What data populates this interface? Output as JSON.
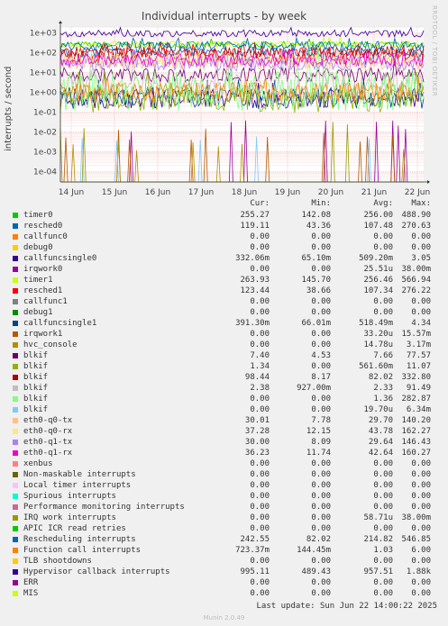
{
  "chart_data": {
    "type": "line",
    "title": "Individual interrupts - by week",
    "ylabel": "interrupts / second",
    "y_scale": "log",
    "ylim": [
      3e-05,
      2000
    ],
    "y_ticks": [
      "1e+03",
      "1e+02",
      "1e+01",
      "1e+00",
      "1e-01",
      "1e-02",
      "1e-03",
      "1e-04"
    ],
    "x_ticks": [
      "14 Jun",
      "15 Jun",
      "16 Jun",
      "17 Jun",
      "18 Jun",
      "19 Jun",
      "20 Jun",
      "21 Jun",
      "22 Jun"
    ],
    "grid": true,
    "columns": [
      "Cur:",
      "Min:",
      "Avg:",
      "Max:"
    ],
    "series": [
      {
        "name": "timer0",
        "color": "#00cc00",
        "cur": "255.27",
        "min": "142.08",
        "avg": "256.00",
        "max": "488.90"
      },
      {
        "name": "resched0",
        "color": "#0066b3",
        "cur": "119.11",
        "min": "43.36",
        "avg": "107.48",
        "max": "270.63"
      },
      {
        "name": "callfunc0",
        "color": "#ff8000",
        "cur": "0.00",
        "min": "0.00",
        "avg": "0.00",
        "max": "0.00"
      },
      {
        "name": "debug0",
        "color": "#ffcc00",
        "cur": "0.00",
        "min": "0.00",
        "avg": "0.00",
        "max": "0.00"
      },
      {
        "name": "callfuncsingle0",
        "color": "#330099",
        "cur": "332.06m",
        "min": "65.10m",
        "avg": "509.20m",
        "max": "3.05"
      },
      {
        "name": "irqwork0",
        "color": "#990099",
        "cur": "0.00",
        "min": "0.00",
        "avg": "25.51u",
        "max": "38.00m"
      },
      {
        "name": "timer1",
        "color": "#ccff00",
        "cur": "263.93",
        "min": "145.70",
        "avg": "256.46",
        "max": "566.94"
      },
      {
        "name": "resched1",
        "color": "#ff0000",
        "cur": "123.44",
        "min": "38.66",
        "avg": "107.34",
        "max": "276.22"
      },
      {
        "name": "callfunc1",
        "color": "#808080",
        "cur": "0.00",
        "min": "0.00",
        "avg": "0.00",
        "max": "0.00"
      },
      {
        "name": "debug1",
        "color": "#008f00",
        "cur": "0.00",
        "min": "0.00",
        "avg": "0.00",
        "max": "0.00"
      },
      {
        "name": "callfuncsingle1",
        "color": "#00487d",
        "cur": "391.30m",
        "min": "66.01m",
        "avg": "518.49m",
        "max": "4.34"
      },
      {
        "name": "irqwork1",
        "color": "#b35a00",
        "cur": "0.00",
        "min": "0.00",
        "avg": "33.20u",
        "max": "15.57m"
      },
      {
        "name": "hvc_console",
        "color": "#b38f00",
        "cur": "0.00",
        "min": "0.00",
        "avg": "14.78u",
        "max": "3.17m"
      },
      {
        "name": "blkif",
        "color": "#6b006b",
        "cur": "7.40",
        "min": "4.53",
        "avg": "7.66",
        "max": "77.57"
      },
      {
        "name": "blkif",
        "color": "#8fb300",
        "cur": "1.34",
        "min": "0.00",
        "avg": "561.60m",
        "max": "11.07"
      },
      {
        "name": "blkif",
        "color": "#b30000",
        "cur": "98.44",
        "min": "8.17",
        "avg": "82.02",
        "max": "332.80"
      },
      {
        "name": "blkif",
        "color": "#bebebe",
        "cur": "2.38",
        "min": "927.00m",
        "avg": "2.33",
        "max": "91.49"
      },
      {
        "name": "blkif",
        "color": "#80ff80",
        "cur": "0.00",
        "min": "0.00",
        "avg": "1.36",
        "max": "282.87"
      },
      {
        "name": "blkif",
        "color": "#80c9ff",
        "cur": "0.00",
        "min": "0.00",
        "avg": "19.70u",
        "max": "6.34m"
      },
      {
        "name": "eth0-q0-tx",
        "color": "#ffc080",
        "cur": "30.01",
        "min": "7.78",
        "avg": "29.70",
        "max": "140.20"
      },
      {
        "name": "eth0-q0-rx",
        "color": "#ffe680",
        "cur": "37.28",
        "min": "12.15",
        "avg": "43.78",
        "max": "162.27"
      },
      {
        "name": "eth0-q1-tx",
        "color": "#aa80ff",
        "cur": "30.00",
        "min": "8.09",
        "avg": "29.64",
        "max": "146.43"
      },
      {
        "name": "eth0-q1-rx",
        "color": "#ee00cc",
        "cur": "36.23",
        "min": "11.74",
        "avg": "42.64",
        "max": "160.27"
      },
      {
        "name": "xenbus",
        "color": "#ff8080",
        "cur": "0.00",
        "min": "0.00",
        "avg": "0.00",
        "max": "0.00"
      },
      {
        "name": "Non-maskable interrupts",
        "color": "#666600",
        "cur": "0.00",
        "min": "0.00",
        "avg": "0.00",
        "max": "0.00"
      },
      {
        "name": "Local timer interrupts",
        "color": "#ffbfff",
        "cur": "0.00",
        "min": "0.00",
        "avg": "0.00",
        "max": "0.00"
      },
      {
        "name": "Spurious interrupts",
        "color": "#00ffcc",
        "cur": "0.00",
        "min": "0.00",
        "avg": "0.00",
        "max": "0.00"
      },
      {
        "name": "Performance monitoring interrupts",
        "color": "#cc6699",
        "cur": "0.00",
        "min": "0.00",
        "avg": "0.00",
        "max": "0.00"
      },
      {
        "name": "IRQ work interrupts",
        "color": "#999900",
        "cur": "0.00",
        "min": "0.00",
        "avg": "58.71u",
        "max": "38.00m"
      },
      {
        "name": "APIC ICR read retries",
        "color": "#00cc00",
        "cur": "0.00",
        "min": "0.00",
        "avg": "0.00",
        "max": "0.00"
      },
      {
        "name": "Rescheduling interrupts",
        "color": "#0066b3",
        "cur": "242.55",
        "min": "82.02",
        "avg": "214.82",
        "max": "546.85"
      },
      {
        "name": "Function call interrupts",
        "color": "#ff8000",
        "cur": "723.37m",
        "min": "144.45m",
        "avg": "1.03",
        "max": "6.00"
      },
      {
        "name": "TLB shootdowns",
        "color": "#ffcc00",
        "cur": "0.00",
        "min": "0.00",
        "avg": "0.00",
        "max": "0.00"
      },
      {
        "name": "Hypervisor callback interrupts",
        "color": "#330099",
        "cur": "995.11",
        "min": "489.43",
        "avg": "957.51",
        "max": "1.88k"
      },
      {
        "name": "ERR",
        "color": "#990099",
        "cur": "0.00",
        "min": "0.00",
        "avg": "0.00",
        "max": "0.00"
      },
      {
        "name": "MIS",
        "color": "#ccff00",
        "cur": "0.00",
        "min": "0.00",
        "avg": "0.00",
        "max": "0.00"
      }
    ]
  },
  "watermark": "RRDTOOL / TOBI OETIKER",
  "last_update": "Last update: Sun Jun 22 14:00:22 2025",
  "munin_version": "Munin 2.0.49"
}
